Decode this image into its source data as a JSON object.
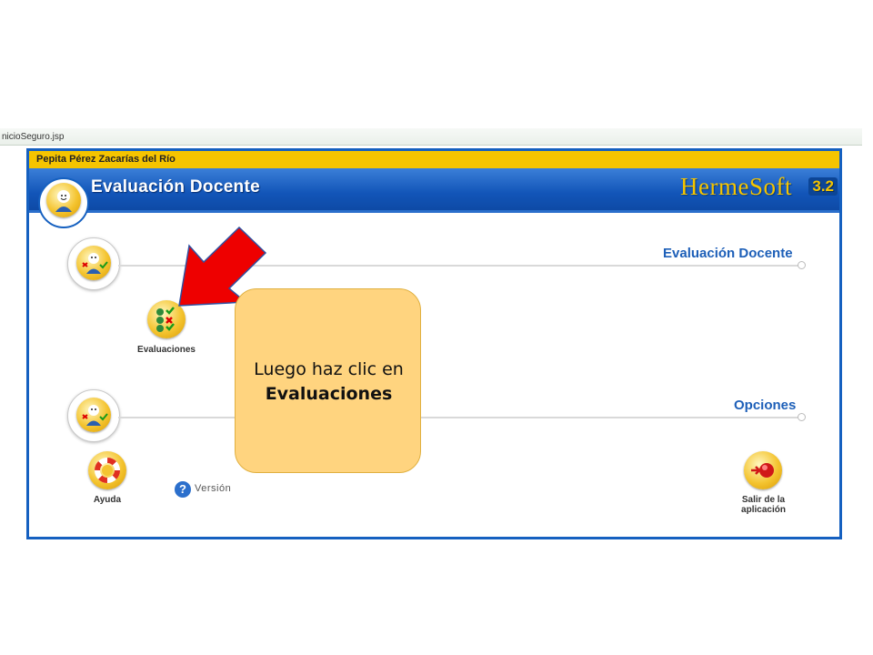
{
  "browser": {
    "url": "nicioSeguro.jsp"
  },
  "user": {
    "name": "Pepita Pérez Zacarías del Río"
  },
  "header": {
    "title": "Evaluación Docente",
    "brand": "HermeSoft",
    "version": "3.2"
  },
  "sections": {
    "evaluacion": {
      "title": "Evaluación Docente"
    },
    "opciones": {
      "title": "Opciones"
    }
  },
  "tools": {
    "evaluaciones": "Evaluaciones",
    "ayuda": "Ayuda",
    "version": "Versión",
    "salir_line1": "Salir de la",
    "salir_line2": "aplicación"
  },
  "callout": {
    "text": "Luego haz clic en",
    "bold": "Evaluaciones"
  },
  "colors": {
    "accent": "#1560c0",
    "userbar": "#f5c400",
    "callout": "#ffd47f",
    "arrow": "#f00000"
  }
}
